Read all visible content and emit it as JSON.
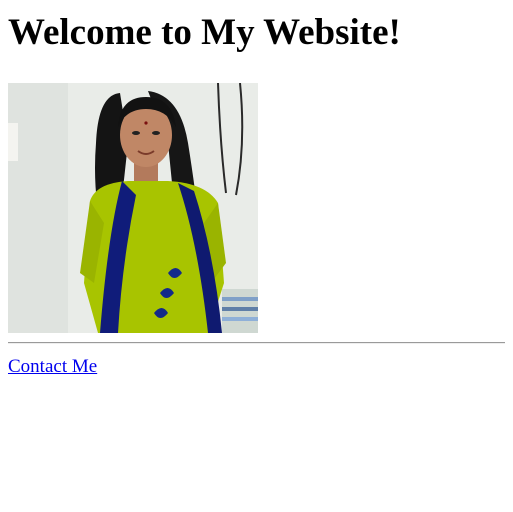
{
  "page": {
    "heading": "Welcome to My Website!",
    "contact_link": "Contact Me"
  },
  "colors": {
    "link": "#0000ee",
    "divider": "#9a9a9a",
    "dress_green": "#a8c400",
    "dupatta_navy": "#101c7a"
  },
  "image": {
    "kind": "portrait-photo"
  }
}
